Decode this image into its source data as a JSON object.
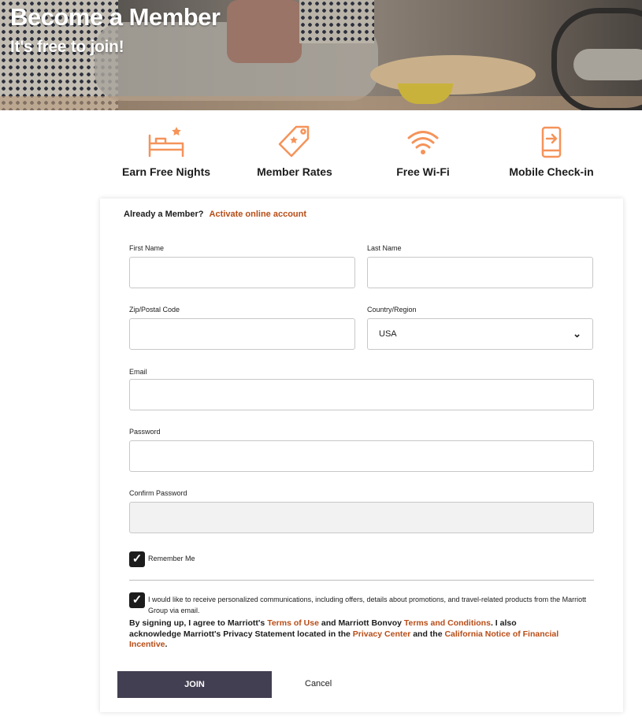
{
  "hero": {
    "title": "Become a Member",
    "subtitle": "It's free to join!"
  },
  "benefits": [
    {
      "label": "Earn Free Nights",
      "icon": "bed-star-icon"
    },
    {
      "label": "Member Rates",
      "icon": "price-tag-icon"
    },
    {
      "label": "Free Wi-Fi",
      "icon": "wifi-icon"
    },
    {
      "label": "Mobile Check-in",
      "icon": "phone-checkin-icon"
    }
  ],
  "form": {
    "already_member_text": "Already a Member?",
    "activate_link": "Activate online account",
    "first_name_label": "First Name",
    "first_name_value": "",
    "last_name_label": "Last Name",
    "last_name_value": "",
    "zip_label": "Zip/Postal Code",
    "zip_value": "",
    "country_label": "Country/Region",
    "country_value": "USA",
    "email_label": "Email",
    "email_value": "",
    "password_label": "Password",
    "password_value": "",
    "confirm_password_label": "Confirm Password",
    "confirm_password_value": "",
    "remember_me_label": "Remember Me",
    "remember_me_checked": true,
    "consent_checked": true,
    "consent_text": "I would like to receive personalized communications, including offers, details about promotions, and travel-related products from the Marriott Group via email.",
    "legal": {
      "part1": "By signing up, I agree to Marriott's ",
      "terms_of_use": "Terms of Use",
      "part2": " and Marriott Bonvoy ",
      "terms_conditions": "Terms and Conditions",
      "part3": ". I also acknowledge Marriott's Privacy Statement located in the ",
      "privacy_center": "Privacy Center",
      "part4": " and the ",
      "california_notice": "California Notice of Financial Incentive",
      "part5": "."
    },
    "join_label": "JOIN",
    "cancel_label": "Cancel"
  },
  "colors": {
    "accent_orange": "#f5935a",
    "link": "#b84c16",
    "button": "#433f52"
  }
}
